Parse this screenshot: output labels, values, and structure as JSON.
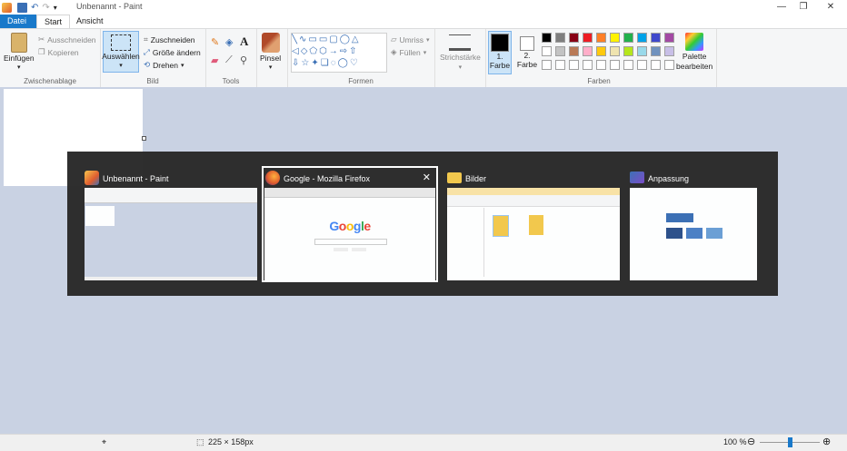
{
  "window": {
    "title": "Unbenannt - Paint",
    "min_label": "—",
    "max_label": "❐",
    "close_label": "✕"
  },
  "tabs": {
    "file": "Datei",
    "start": "Start",
    "view": "Ansicht"
  },
  "ribbon": {
    "clipboard": {
      "paste": "Einfügen",
      "cut": "Ausschneiden",
      "copy": "Kopieren",
      "label": "Zwischenablage"
    },
    "image": {
      "select": "Auswählen",
      "crop": "Zuschneiden",
      "resize": "Größe ändern",
      "rotate": "Drehen",
      "label": "Bild"
    },
    "tools": {
      "label": "Tools",
      "text_tool": "A"
    },
    "brushes": {
      "label": "Pinsel"
    },
    "shapes": {
      "outline": "Umriss",
      "fill": "Füllen",
      "label": "Formen"
    },
    "size": {
      "label": "Strichstärke"
    },
    "color1": {
      "line1": "1.",
      "line2": "Farbe"
    },
    "color2": {
      "line1": "2.",
      "line2": "Farbe"
    },
    "edit_colors": {
      "line1": "Palette",
      "line2": "bearbeiten"
    },
    "colors_label": "Farben",
    "palette_row1": [
      "#000000",
      "#7f7f7f",
      "#880015",
      "#ed1c24",
      "#ff7f27",
      "#fff200",
      "#22b14c",
      "#00a2e8",
      "#3f48cc",
      "#a349a4"
    ],
    "palette_row2": [
      "#ffffff",
      "#c3c3c3",
      "#b97a57",
      "#ffaec9",
      "#ffc90e",
      "#efe4b0",
      "#b5e61d",
      "#99d9ea",
      "#7092be",
      "#c8bfe7"
    ],
    "palette_row3": [
      "#ffffff",
      "#ffffff",
      "#ffffff",
      "#ffffff",
      "#ffffff",
      "#ffffff",
      "#ffffff",
      "#ffffff",
      "#ffffff",
      "#ffffff"
    ]
  },
  "switcher": {
    "tiles": [
      {
        "title": "Unbenannt - Paint",
        "icon": "paint-icon"
      },
      {
        "title": "Google - Mozilla Firefox",
        "icon": "firefox-icon",
        "close": "✕",
        "logo": "Google"
      },
      {
        "title": "Bilder",
        "icon": "folder-icon"
      },
      {
        "title": "Anpassung",
        "icon": "personalization-icon"
      }
    ]
  },
  "status": {
    "dimensions": "225 × 158px",
    "zoom": "100 %",
    "zoom_level": 1.0
  }
}
